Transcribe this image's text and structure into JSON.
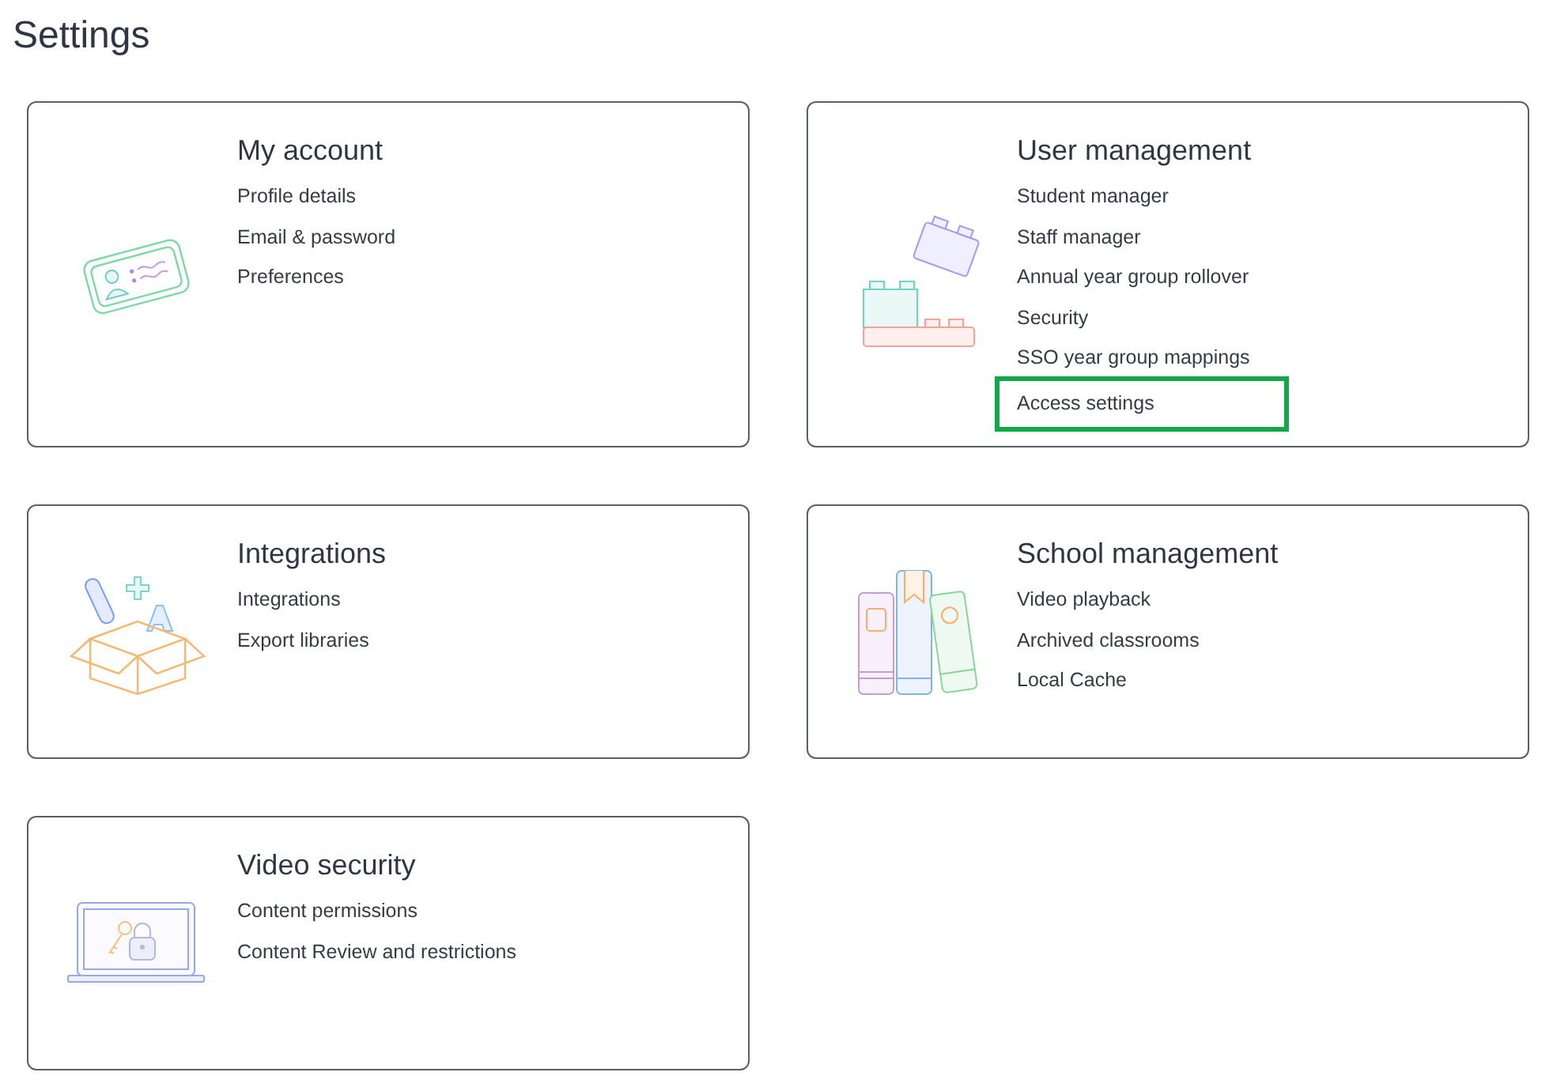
{
  "page_title": "Settings",
  "sections": [
    {
      "title": "My account",
      "links": [
        {
          "label": "Profile details",
          "highlighted": false
        },
        {
          "label": "Email & password",
          "highlighted": false
        },
        {
          "label": "Preferences",
          "highlighted": false
        }
      ]
    },
    {
      "title": "User management",
      "links": [
        {
          "label": "Student manager",
          "highlighted": false
        },
        {
          "label": "Staff manager",
          "highlighted": false
        },
        {
          "label": "Annual year group rollover",
          "highlighted": false
        },
        {
          "label": "Security",
          "highlighted": false
        },
        {
          "label": "SSO year group mappings",
          "highlighted": false
        },
        {
          "label": "Access settings",
          "highlighted": true
        }
      ]
    },
    {
      "title": "Integrations",
      "links": [
        {
          "label": "Integrations",
          "highlighted": false
        },
        {
          "label": "Export libraries",
          "highlighted": false
        }
      ]
    },
    {
      "title": "School management",
      "links": [
        {
          "label": "Video playback",
          "highlighted": false
        },
        {
          "label": "Archived classrooms",
          "highlighted": false
        },
        {
          "label": "Local Cache",
          "highlighted": false
        }
      ]
    },
    {
      "title": "Video security",
      "links": [
        {
          "label": "Content permissions",
          "highlighted": false
        },
        {
          "label": "Content Review and restrictions",
          "highlighted": false
        }
      ]
    }
  ]
}
